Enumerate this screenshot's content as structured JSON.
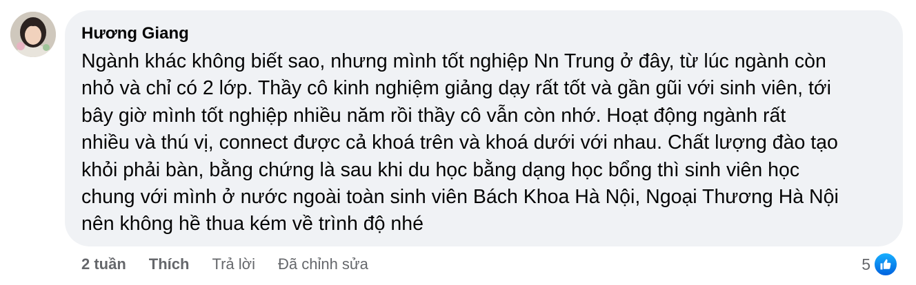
{
  "comment": {
    "author": "Hương Giang",
    "text": "Ngành khác không biết sao, nhưng mình tốt nghiệp Nn Trung ở đây, từ lúc ngành còn\nnhỏ và chỉ có 2 lớp. Thầy cô kinh nghiệm giảng dạy rất tốt và gần gũi với sinh viên, tới\nbây giờ mình tốt nghiệp nhiều năm rồi thầy cô vẫn còn nhớ. Hoạt động ngành rất\nnhiều và thú vị, connect được cả khoá trên và khoá dưới với nhau. Chất lượng đào tạo\nkhỏi phải bàn, bằng chứng là sau khi du học bằng dạng học bổng thì sinh viên học\nchung với mình ở nước ngoài toàn sinh viên Bách Khoa Hà Nội, Ngoại Thương Hà Nội\nnên không hề thua kém về trình độ nhé",
    "avatar_icon": "profile-photo",
    "bubble_color": "#f0f2f5"
  },
  "actions": {
    "time": "2 tuần",
    "like": "Thích",
    "reply": "Trả lời",
    "edited": "Đã chỉnh sửa"
  },
  "reactions": {
    "count": "5",
    "icon": "like-icon",
    "icon_color": "#1877f2"
  }
}
